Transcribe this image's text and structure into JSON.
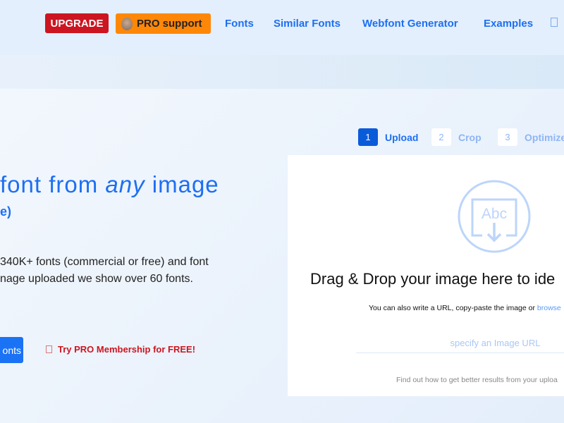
{
  "header": {
    "upgrade": "UPGRADE",
    "pro_support": "PRO support",
    "nav": [
      "Fonts",
      "Similar Fonts",
      "Webfont Generator",
      "Examples"
    ],
    "lang_icon": "language-icon"
  },
  "hero": {
    "title_pre": "font from ",
    "title_em": "any",
    "title_post": " image",
    "subtitle": "e)",
    "desc_line1": "340K+ fonts (commercial or free) and font",
    "desc_line2": "nage uploaded we show over 60 fonts.",
    "fonts_button": "onts",
    "try_pro": "Try PRO Membership for FREE!"
  },
  "steps": [
    {
      "num": "1",
      "label": "Upload"
    },
    {
      "num": "2",
      "label": "Crop"
    },
    {
      "num": "3",
      "label": "Optimize"
    }
  ],
  "upload": {
    "icon_text": "Abc",
    "drag_drop": "Drag & Drop your image here to ide",
    "also_text": "You can also write a URL, copy-paste the image or ",
    "browse": "browse",
    "url_placeholder": "specify an Image URL",
    "find_out": "Find out how to get better results from your uploa"
  },
  "colors": {
    "accent": "#1d6ff2",
    "upgrade": "#cc1520",
    "pro": "#ff8708"
  }
}
